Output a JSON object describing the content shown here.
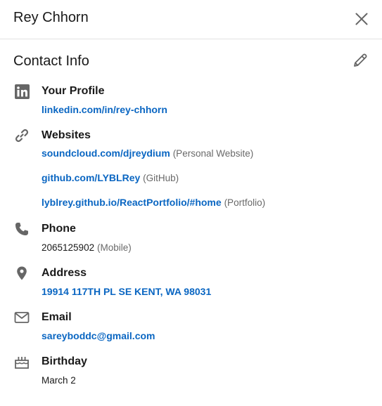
{
  "header": {
    "title": "Rey Chhorn"
  },
  "section": {
    "title": "Contact Info"
  },
  "profile": {
    "label": "Your Profile",
    "url": "linkedin.com/in/rey-chhorn"
  },
  "websites": {
    "label": "Websites",
    "items": [
      {
        "url": "soundcloud.com/djreydium",
        "type": "(Personal Website)"
      },
      {
        "url": "github.com/LYBLRey",
        "type": "(GitHub)"
      },
      {
        "url": "lyblrey.github.io/ReactPortfolio/#home",
        "type": "(Portfolio)"
      }
    ]
  },
  "phone": {
    "label": "Phone",
    "number": "2065125902",
    "type": "(Mobile)"
  },
  "address": {
    "label": "Address",
    "value": "19914 117TH PL SE KENT, WA 98031"
  },
  "email": {
    "label": "Email",
    "value": "sareyboddc@gmail.com"
  },
  "birthday": {
    "label": "Birthday",
    "value": "March 2"
  },
  "icons": {
    "close": "close-icon",
    "edit": "pencil-icon",
    "profile": "linkedin-icon",
    "websites": "link-icon",
    "phone": "phone-icon",
    "address": "location-pin-icon",
    "email": "envelope-icon",
    "birthday": "cake-icon"
  },
  "colors": {
    "link": "#0a66c2",
    "icon": "#666666",
    "text": "#191919",
    "muted": "#666666"
  }
}
